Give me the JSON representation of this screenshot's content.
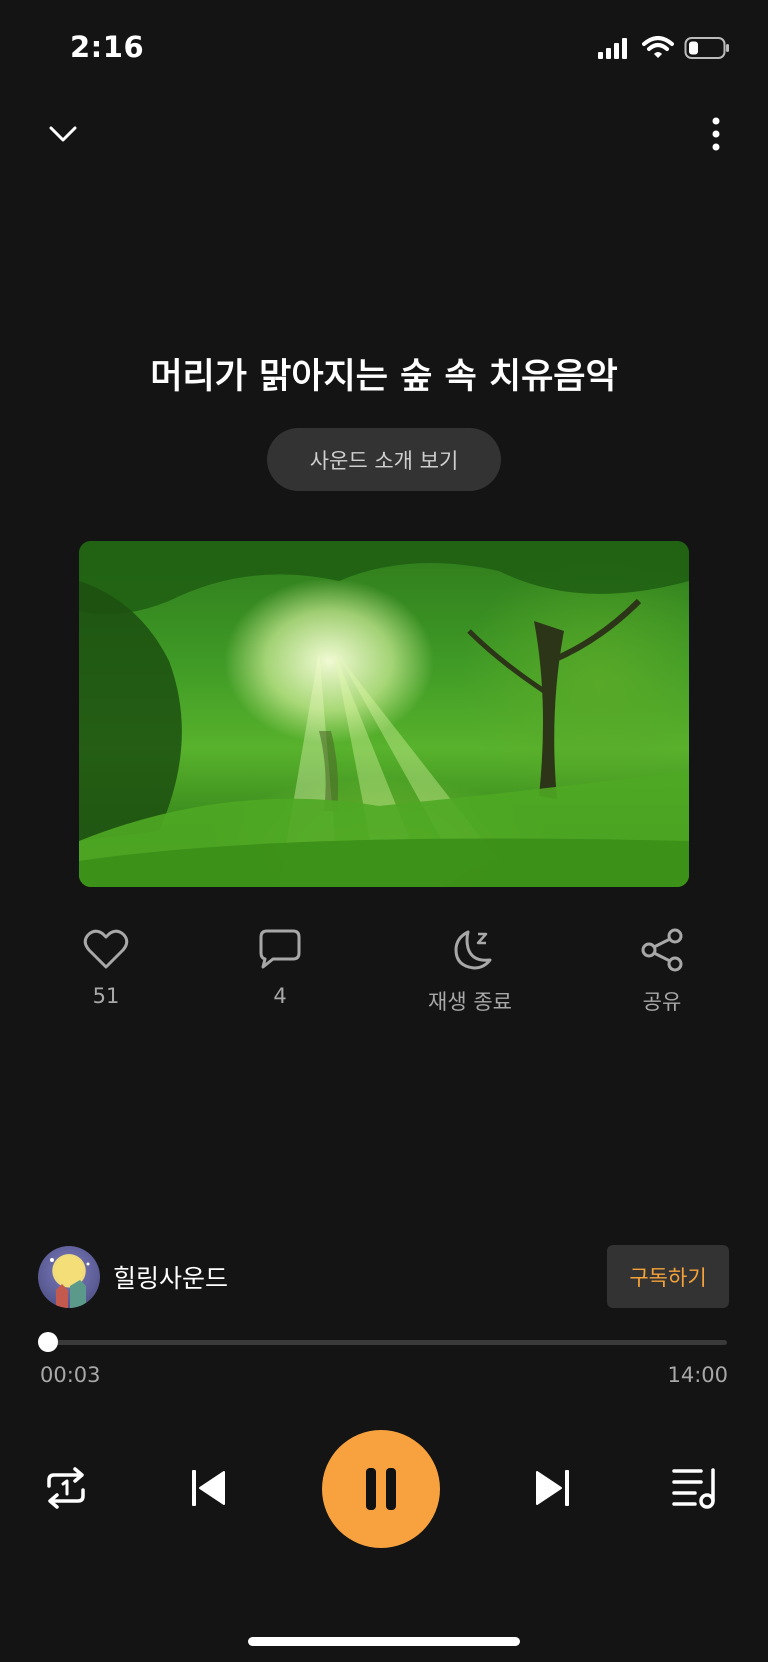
{
  "status_bar": {
    "time": "2:16"
  },
  "title": "머리가 맑아지는 숲 속 치유음악",
  "intro_button_label": "사운드 소개 보기",
  "actions": {
    "likes": "51",
    "comments": "4",
    "sleep_timer_label": "재생 종료",
    "share_label": "공유"
  },
  "channel": {
    "name": "힐링사운드",
    "subscribe_label": "구독하기"
  },
  "player": {
    "current_time": "00:03",
    "total_time": "14:00",
    "progress": 0.004
  },
  "colors": {
    "accent": "#f7a23e",
    "background": "#141414"
  },
  "icons": [
    "chevron-down-icon",
    "more-vertical-icon",
    "heart-icon",
    "comment-icon",
    "moon-sleep-icon",
    "share-icon",
    "repeat-one-icon",
    "skip-previous-icon",
    "pause-icon",
    "skip-next-icon",
    "playlist-icon"
  ]
}
